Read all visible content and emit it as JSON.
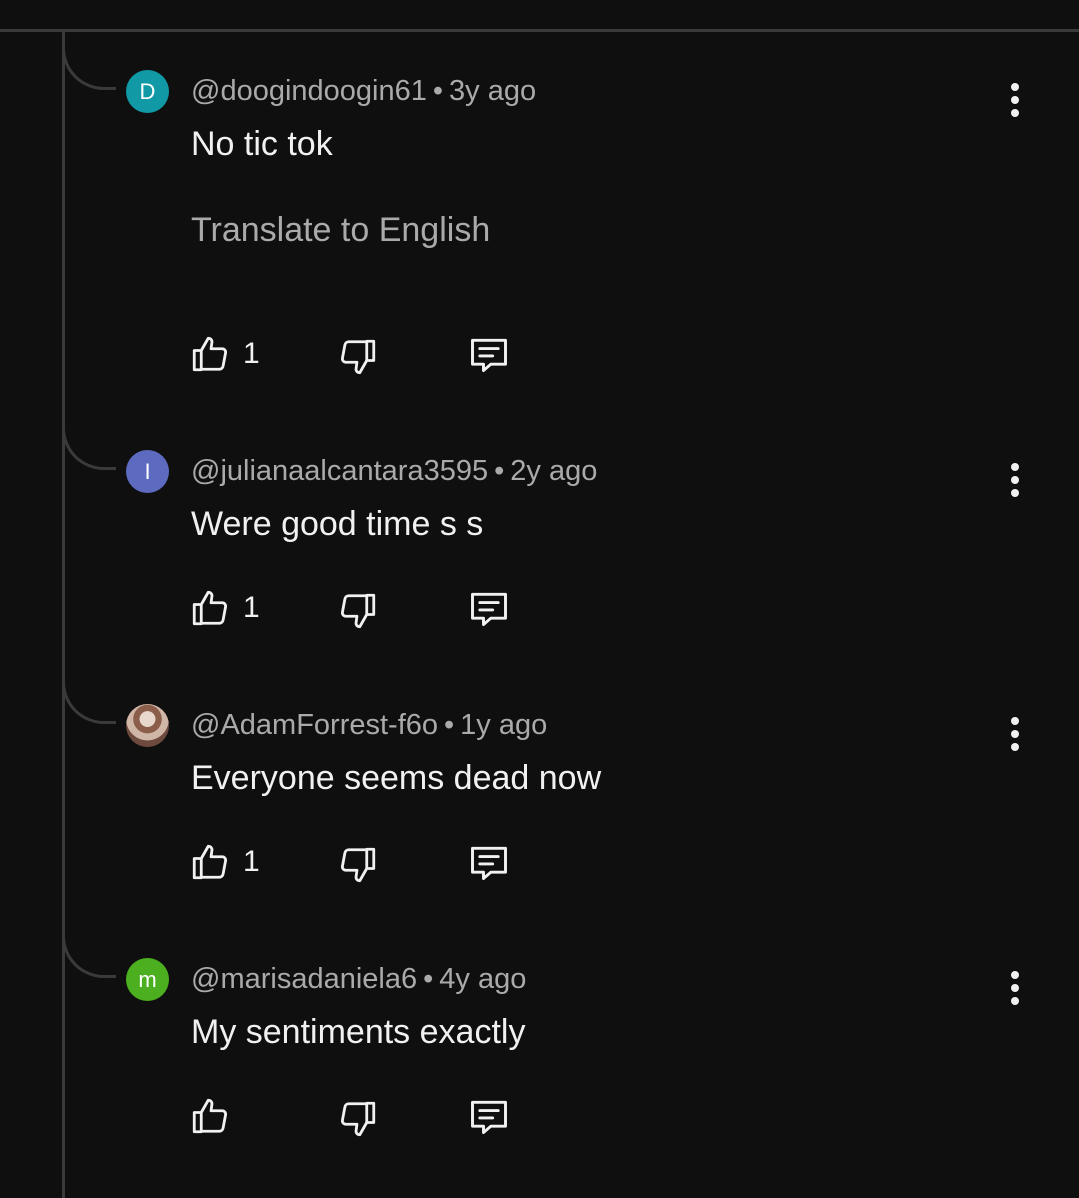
{
  "replies": [
    {
      "avatar_letter": "D",
      "avatar_color": "#1199a6",
      "handle": "@doogindoogin61",
      "separator": "•",
      "time": "3y ago",
      "text": "No tic tok",
      "translate_label": "Translate to English",
      "likes": "1"
    },
    {
      "avatar_letter": "I",
      "avatar_color": "#5c6bc0",
      "handle": "@julianaalcantara3595",
      "separator": "•",
      "time": "2y ago",
      "text": "Were good time s s",
      "likes": "1"
    },
    {
      "avatar_letter": "",
      "avatar_color": "#8b5e4b",
      "handle": "@AdamForrest-f6o",
      "separator": "•",
      "time": "1y ago",
      "text": "Everyone seems dead now",
      "likes": "1"
    },
    {
      "avatar_letter": "m",
      "avatar_color": "#4caf1f",
      "handle": "@marisadaniela6",
      "separator": "•",
      "time": "4y ago",
      "text": "My sentiments exactly",
      "likes": ""
    }
  ],
  "icons": {
    "like": "thumbs-up-icon",
    "dislike": "thumbs-down-icon",
    "reply": "reply-comment-icon",
    "more": "more-vertical-icon"
  }
}
